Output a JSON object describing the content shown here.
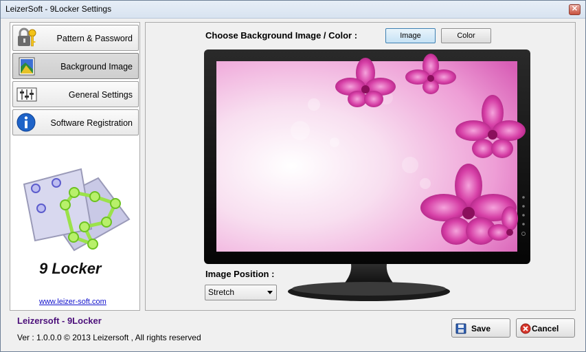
{
  "window": {
    "title": "LeizerSoft - 9Locker Settings",
    "close_glyph": "✕"
  },
  "sidebar": {
    "items": [
      {
        "label": "Pattern & Password",
        "icon": "padlock-key-icon"
      },
      {
        "label": "Background Image",
        "icon": "picture-icon"
      },
      {
        "label": "General Settings",
        "icon": "sliders-icon"
      },
      {
        "label": "Software Registration",
        "icon": "info-icon"
      }
    ],
    "logo_text": "9 Locker",
    "website": "www.leizer-soft.com"
  },
  "main": {
    "choose_label": "Choose Background Image / Color :",
    "image_button": "Image",
    "color_button": "Color",
    "position_label": "Image Position :",
    "position_value": "Stretch"
  },
  "footer": {
    "app_name": "Leizersoft - 9Locker",
    "version": "Ver :  1.0.0.0    © 2013 Leizersoft , All rights reserved",
    "save_label": "Save",
    "cancel_label": "Cancel"
  },
  "colors": {
    "accent": "#4b0f7a",
    "link": "#1010cc",
    "orchid": "#d63fa6"
  }
}
